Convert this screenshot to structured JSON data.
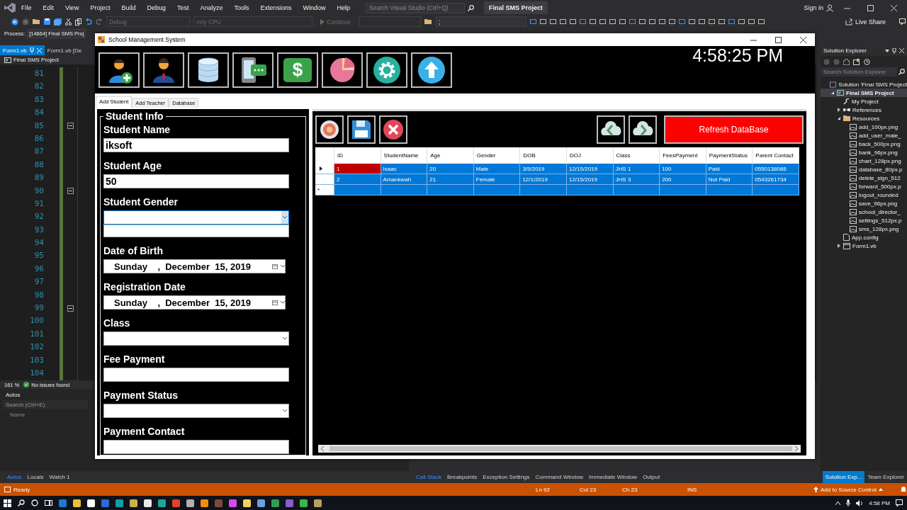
{
  "vs": {
    "menu": [
      "File",
      "Edit",
      "View",
      "Project",
      "Build",
      "Debug",
      "Test",
      "Analyze",
      "Tools",
      "Extensions",
      "Window",
      "Help"
    ],
    "search": {
      "placeholder": "Search Visual Studio (Ctrl+Q)"
    },
    "solution_title": "Final SMS Project",
    "sign_in": "Sign in"
  },
  "toolbar": {
    "configuration": "Debug",
    "platform": "Any CPU",
    "continue": "Continue",
    "field_value": ";",
    "live_share": "Live Share"
  },
  "process": {
    "label": "Process:",
    "value": "[14664] Final SMS Proj"
  },
  "doc_tabs": [
    {
      "label": "Form1.vb",
      "selected": true
    },
    {
      "label": "Form1.vb [De",
      "selected": false
    }
  ],
  "nav_bar": {
    "project": "Final SMS Project"
  },
  "code": {
    "lines": [
      {
        "number": "81",
        "foldable": false
      },
      {
        "number": "82",
        "foldable": false
      },
      {
        "number": "83",
        "foldable": false
      },
      {
        "number": "84",
        "foldable": false
      },
      {
        "number": "85",
        "foldable": true
      },
      {
        "number": "86",
        "foldable": false
      },
      {
        "number": "87",
        "foldable": false
      },
      {
        "number": "88",
        "foldable": false
      },
      {
        "number": "89",
        "foldable": false
      },
      {
        "number": "90",
        "foldable": true
      },
      {
        "number": "91",
        "foldable": false
      },
      {
        "number": "92",
        "foldable": false
      },
      {
        "number": "93",
        "foldable": false
      },
      {
        "number": "94",
        "foldable": false
      },
      {
        "number": "95",
        "foldable": false
      },
      {
        "number": "96",
        "foldable": false
      },
      {
        "number": "97",
        "foldable": false
      },
      {
        "number": "98",
        "foldable": false
      },
      {
        "number": "99",
        "foldable": true
      },
      {
        "number": "100",
        "foldable": false
      },
      {
        "number": "101",
        "foldable": false
      },
      {
        "number": "102",
        "foldable": false
      },
      {
        "number": "103",
        "foldable": false
      },
      {
        "number": "104",
        "foldable": false
      }
    ]
  },
  "editor_status": {
    "zoom": "161 %",
    "issues": "No issues found"
  },
  "autos": {
    "title": "Autos",
    "search": {
      "placeholder": "Search (Ctrl+E)"
    },
    "columns": [
      "Name"
    ]
  },
  "tool_tabs_left": [
    {
      "label": "Autos",
      "selected": true
    },
    {
      "label": "Locals",
      "selected": false
    },
    {
      "label": "Watch 1",
      "selected": false
    }
  ],
  "tool_tabs_center": [
    {
      "label": "Call Stack",
      "selected": true
    },
    {
      "label": "Breakpoints",
      "selected": false
    },
    {
      "label": "Exception Settings",
      "selected": false
    },
    {
      "label": "Command Window",
      "selected": false
    },
    {
      "label": "Immediate Window",
      "selected": false
    },
    {
      "label": "Output",
      "selected": false
    }
  ],
  "tool_tabs_right": [
    {
      "label": "Solution Exp...",
      "selected": true
    },
    {
      "label": "Team Explorer",
      "selected": false
    }
  ],
  "status_bar": {
    "ready": "Ready",
    "line": "Ln 92",
    "column": "Col 23",
    "char": "Ch 23",
    "mode": "INS",
    "source_control": "Add to Source Control"
  },
  "taskbar": {
    "time": "4:58 PM"
  },
  "solution_explorer": {
    "title": "Solution Explorer",
    "search": {
      "placeholder": "Search Solution Explorer"
    },
    "tree": [
      {
        "kind": "solution",
        "label": "Solution 'Final SMS Project",
        "selected": false,
        "children": [
          {
            "kind": "project",
            "label": "Final SMS Project",
            "selected": true,
            "expanded": true,
            "children": [
              {
                "kind": "wrench",
                "label": "My Project",
                "selected": false
              },
              {
                "kind": "references",
                "label": "References",
                "selected": false,
                "expanded": false
              },
              {
                "kind": "folder",
                "label": "Resources",
                "selected": false,
                "expanded": true,
                "children": [
                  {
                    "kind": "image",
                    "label": "add_100px.png",
                    "selected": false
                  },
                  {
                    "kind": "image",
                    "label": "add_user_male_",
                    "selected": false
                  },
                  {
                    "kind": "image",
                    "label": "back_500px.png",
                    "selected": false
                  },
                  {
                    "kind": "image",
                    "label": "bank_96px.png",
                    "selected": false
                  },
                  {
                    "kind": "image",
                    "label": "chart_128px.png",
                    "selected": false
                  },
                  {
                    "kind": "image",
                    "label": "database_80px.p",
                    "selected": false
                  },
                  {
                    "kind": "image",
                    "label": "delete_sign_512",
                    "selected": false
                  },
                  {
                    "kind": "image",
                    "label": "forward_500px.p",
                    "selected": false
                  },
                  {
                    "kind": "image",
                    "label": "logout_rounded",
                    "selected": false
                  },
                  {
                    "kind": "image",
                    "label": "save_96px.png",
                    "selected": false
                  },
                  {
                    "kind": "image",
                    "label": "school_director_",
                    "selected": false
                  },
                  {
                    "kind": "image",
                    "label": "settings_512px.p",
                    "selected": false
                  },
                  {
                    "kind": "image",
                    "label": "sms_128px.png",
                    "selected": false
                  }
                ]
              },
              {
                "kind": "config",
                "label": "App.config",
                "selected": false
              },
              {
                "kind": "form",
                "label": "Form1.vb",
                "selected": false,
                "expanded": false
              }
            ]
          }
        ]
      }
    ]
  },
  "app": {
    "title": "School Management System",
    "clock": "4:58:25 PM",
    "dollar_symbol": "$",
    "tabs": [
      {
        "label": "Add Student",
        "selected": true
      },
      {
        "label": "Add Teacher",
        "selected": false
      },
      {
        "label": "Database",
        "selected": false
      }
    ],
    "student_info": {
      "title": "Student Info",
      "fields": [
        {
          "kind": "text",
          "label": "Student Name",
          "value": "iksoft"
        },
        {
          "kind": "text",
          "label": "Student Age",
          "value": "50"
        },
        {
          "kind": "combo",
          "label": "Student Gender",
          "expanded": true
        },
        {
          "kind": "date",
          "label": "Date of Birth",
          "value": "Sunday    ,  December  15, 2019"
        },
        {
          "kind": "date",
          "label": "Registration Date",
          "value": "Sunday    ,  December  15, 2019"
        },
        {
          "kind": "combo",
          "label": "Class",
          "expanded": false
        },
        {
          "kind": "text",
          "label": "Fee Payment"
        },
        {
          "kind": "combo",
          "label": "Payment Status",
          "expanded": false
        },
        {
          "kind": "text",
          "label": "Payment Contact"
        }
      ]
    },
    "grid": {
      "refresh_button": "Refresh DataBase",
      "new_row_marker": "*",
      "columns": [
        "ID",
        "StudentName",
        "Age",
        "Gender",
        "DOB",
        "DOJ",
        "Class",
        "FeesPayment",
        "PaymentStatus",
        "Parent Contact"
      ],
      "rows": [
        {
          "selected": true,
          "current": true,
          "cells": [
            "1",
            "Isaac",
            "20",
            "Male",
            "3/5/2019",
            "12/15/2019",
            "JHS 1",
            "100",
            "Paid",
            "0550138086"
          ]
        },
        {
          "selected": true,
          "current": false,
          "cells": [
            "2",
            "Amankwah",
            "21",
            "Female",
            "12/1/2019",
            "12/15/2019",
            "JHS 3",
            "200",
            "Not Paid",
            "0543261734"
          ]
        }
      ]
    }
  }
}
